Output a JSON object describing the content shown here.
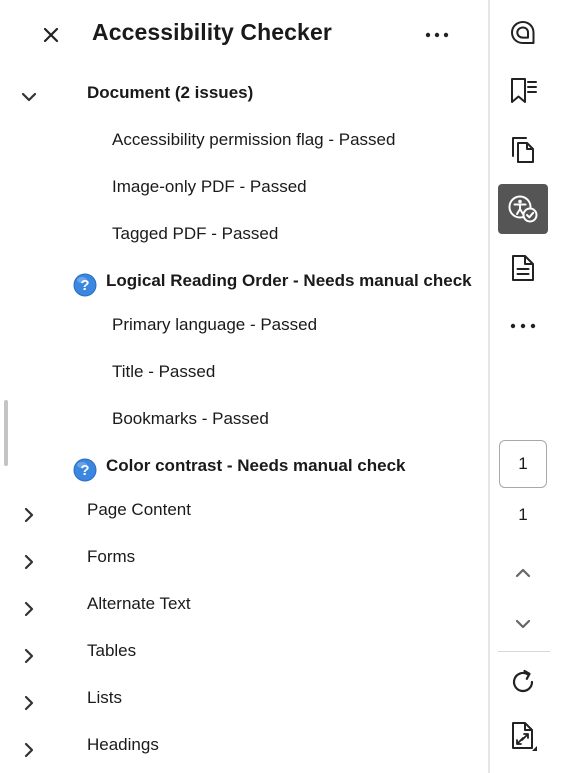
{
  "panel": {
    "title": "Accessibility Checker",
    "icons": {
      "close": "close-icon",
      "more": "more-horizontal-icon"
    }
  },
  "tree": {
    "document": {
      "label": "Document (2 issues)",
      "expanded": true,
      "children": [
        {
          "label": "Accessibility permission flag - Passed",
          "status": "passed"
        },
        {
          "label": "Image-only PDF - Passed",
          "status": "passed"
        },
        {
          "label": "Tagged PDF - Passed",
          "status": "passed"
        },
        {
          "label": "Logical Reading Order - Needs manual check",
          "status": "manual",
          "icon": "help-icon"
        },
        {
          "label": "Primary language - Passed",
          "status": "passed"
        },
        {
          "label": "Title - Passed",
          "status": "passed"
        },
        {
          "label": "Bookmarks - Passed",
          "status": "passed"
        },
        {
          "label": "Color contrast - Needs manual check",
          "status": "manual",
          "icon": "help-icon"
        }
      ]
    },
    "categories": [
      {
        "label": "Page Content",
        "expanded": false
      },
      {
        "label": "Forms",
        "expanded": false
      },
      {
        "label": "Alternate Text",
        "expanded": false
      },
      {
        "label": "Tables",
        "expanded": false
      },
      {
        "label": "Lists",
        "expanded": false
      },
      {
        "label": "Headings",
        "expanded": false
      }
    ]
  },
  "rail": {
    "tools": [
      {
        "name": "comment-icon",
        "active": false
      },
      {
        "name": "bookmarks-icon",
        "active": false
      },
      {
        "name": "pages-icon",
        "active": false
      },
      {
        "name": "accessibility-icon",
        "active": true
      },
      {
        "name": "document-properties-icon",
        "active": false
      },
      {
        "name": "more-tools-icon",
        "active": false
      }
    ],
    "page": {
      "current": "1",
      "total": "1"
    },
    "nav": {
      "up": "chevron-up-icon",
      "down": "chevron-down-icon",
      "refresh": "refresh-icon",
      "fit": "fit-page-icon"
    }
  },
  "colors": {
    "help_icon": "#3b86e0",
    "active_tool_bg": "#555555",
    "divider": "#e6e6e6"
  }
}
